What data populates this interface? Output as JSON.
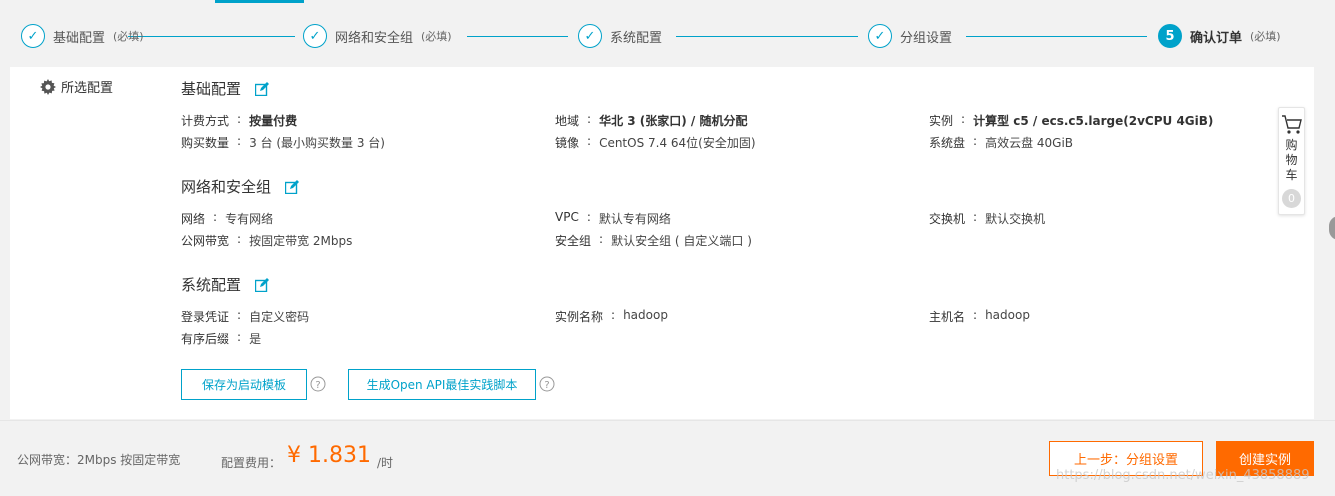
{
  "steps": [
    {
      "label": "基础配置",
      "note": "(必填)",
      "number": "✓",
      "state": "done"
    },
    {
      "label": "网络和安全组",
      "note": "(必填)",
      "number": "✓",
      "state": "done"
    },
    {
      "label": "系统配置",
      "note": "",
      "number": "✓",
      "state": "done"
    },
    {
      "label": "分组设置",
      "note": "",
      "number": "✓",
      "state": "done"
    },
    {
      "label": "确认订单",
      "note": "(必填)",
      "number": "5",
      "state": "active"
    }
  ],
  "side_title": "所选配置",
  "sections": {
    "basic": {
      "title": "基础配置",
      "billing_key": "计费方式",
      "billing_val": "按量付费",
      "region_key": "地域",
      "region_val": "华北 3 (张家口) / 随机分配",
      "instance_key": "实例",
      "instance_val": "计算型 c5 / ecs.c5.large(2vCPU 4GiB)",
      "qty_key": "购买数量",
      "qty_val": "3 台 (最小购买数量 3 台)",
      "image_key": "镜像",
      "image_val": "CentOS 7.4 64位(安全加固)",
      "disk_key": "系统盘",
      "disk_val": "高效云盘 40GiB"
    },
    "network": {
      "title": "网络和安全组",
      "net_key": "网络",
      "net_val": "专有网络",
      "vpc_key": "VPC",
      "vpc_val": "默认专有网络",
      "switch_key": "交换机",
      "switch_val": "默认交换机",
      "bw_key": "公网带宽",
      "bw_val": "按固定带宽 2Mbps",
      "sg_key": "安全组",
      "sg_val": "默认安全组 ( 自定义端口 )"
    },
    "system": {
      "title": "系统配置",
      "login_key": "登录凭证",
      "login_val": "自定义密码",
      "name_key": "实例名称",
      "name_val": "hadoop",
      "host_key": "主机名",
      "host_val": "hadoop",
      "suffix_key": "有序后缀",
      "suffix_val": "是"
    }
  },
  "buttons": {
    "save_template": "保存为启动模板",
    "open_api": "生成Open API最佳实践脚本",
    "prev": "上一步：分组设置",
    "create": "创建实例"
  },
  "cart": {
    "label": "购物车",
    "count": "0"
  },
  "footer": {
    "bandwidth_info": "公网带宽：2Mbps 按固定带宽",
    "fee_label": "配置费用：",
    "fee_price": "¥ 1.831",
    "fee_unit": "/时",
    "watermark": "https://blog.csdn.net/weixin_43858889"
  },
  "colors": {
    "accent": "#00a2ca",
    "orange": "#ff6a00"
  }
}
